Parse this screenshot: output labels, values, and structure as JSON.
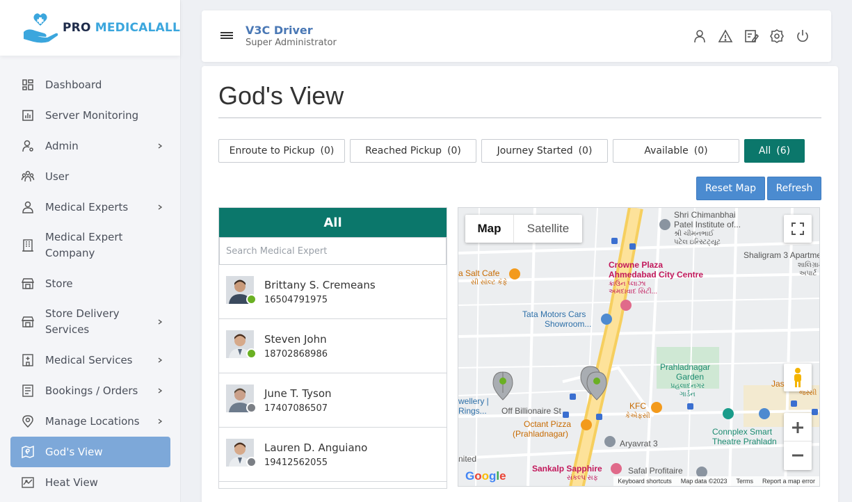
{
  "brand": {
    "pro": "PRO",
    "med": "MEDICALALL"
  },
  "header": {
    "title": "V3C Driver",
    "subtitle": "Super Administrator",
    "icons": [
      "user-icon",
      "alert-icon",
      "edit-icon",
      "settings-icon",
      "power-icon"
    ]
  },
  "sidebar": {
    "items": [
      {
        "label": "Dashboard",
        "icon": "dashboard-icon"
      },
      {
        "label": "Server Monitoring",
        "icon": "chart-icon"
      },
      {
        "label": "Admin",
        "icon": "admin-icon"
      },
      {
        "label": "User",
        "icon": "users-icon"
      },
      {
        "label": "Medical Experts",
        "icon": "person-icon"
      },
      {
        "label": "Medical Expert Company",
        "icon": "building-icon"
      },
      {
        "label": "Store",
        "icon": "store-icon"
      },
      {
        "label": "Store Delivery Services",
        "icon": "store-icon"
      },
      {
        "label": "Medical Services",
        "icon": "hospital-icon"
      },
      {
        "label": "Bookings / Orders",
        "icon": "list-icon"
      },
      {
        "label": "Manage Locations",
        "icon": "location-icon"
      },
      {
        "label": "God's View",
        "icon": "map-icon"
      },
      {
        "label": "Heat View",
        "icon": "heatmap-icon"
      }
    ]
  },
  "page": {
    "title": "God's View"
  },
  "filters": [
    {
      "label": "Enroute to Pickup",
      "count": "(0)"
    },
    {
      "label": "Reached Pickup",
      "count": "(0)"
    },
    {
      "label": "Journey Started",
      "count": "(0)"
    },
    {
      "label": "Available",
      "count": "(0)"
    },
    {
      "label": "All",
      "count": "(6)"
    }
  ],
  "actions": {
    "reset": "Reset Map",
    "refresh": "Refresh"
  },
  "list": {
    "header": "All",
    "search_placeholder": "Search Medical Expert",
    "rows": [
      {
        "name": "Brittany S. Cremeans",
        "phone": "16504791975",
        "status_color": "#6ab023"
      },
      {
        "name": "Steven John",
        "phone": "18702868986",
        "status_color": "#6ab023"
      },
      {
        "name": "June T. Tyson",
        "phone": "17407086507",
        "status_color": "#7b7f85"
      },
      {
        "name": "Lauren D. Anguiano",
        "phone": "19412562055",
        "status_color": "#7b7f85"
      }
    ]
  },
  "map": {
    "tabs": {
      "map": "Map",
      "satellite": "Satellite"
    },
    "labels": {
      "shri1": "Shri Chimanbhai",
      "shri2": "Patel Institute of...",
      "shri3": "શ્રી ચીમનભાઈ",
      "shri4": "પટેલ ઇન્સ્ટિટ્યૂટ",
      "shaligram": "Shaligram 3 Apartmen",
      "shaligram_gu1": "શાલિગ્રામ",
      "shaligram_gu2": "અપાર્ટ",
      "salt1": "a Salt Cafe",
      "salt2": "સી સૉલ્ટ કૅફે",
      "crowne1": "Crowne Plaza",
      "crowne2": "Ahmedabad City Centre",
      "crowne3": "ક્રાઉન પ્લાઝા",
      "crowne4": "અમદાવાદ સિટી...",
      "tata1": "Tata Motors Cars",
      "tata2": "Showroom...",
      "garden1": "Prahladnagar",
      "garden2": "Garden",
      "garden3": "પ્રહલાદનગર",
      "garden4": "ગાર્ડન",
      "jas": "Jas",
      "jas_gu": "જસ્સી",
      "jewellery1": "wellery |",
      "jewellery2": "Rings...",
      "billionaire": "Off Billionaire St",
      "kfc1": "KFC",
      "kfc2": "કેએફસી",
      "octant1": "Octant Pizza",
      "octant2": "(Prahladnagar)",
      "aryavrat": "Aryavrat 3",
      "connplex1": "Connplex Smart",
      "connplex2": "Theatre Prahladn",
      "nited": "nited",
      "sankalp1": "Sankalp Sapphire",
      "sankalp2": "સંકલ્પ સફ",
      "safal": "Safal Profitaire"
    },
    "footer": {
      "shortcuts": "Keyboard shortcuts",
      "data": "Map data ©2023",
      "terms": "Terms",
      "report": "Report a map error"
    },
    "google": "Google"
  },
  "colors": {
    "primary": "#0b776b",
    "accent": "#4b8bd0",
    "active_nav": "#7da8d9"
  }
}
